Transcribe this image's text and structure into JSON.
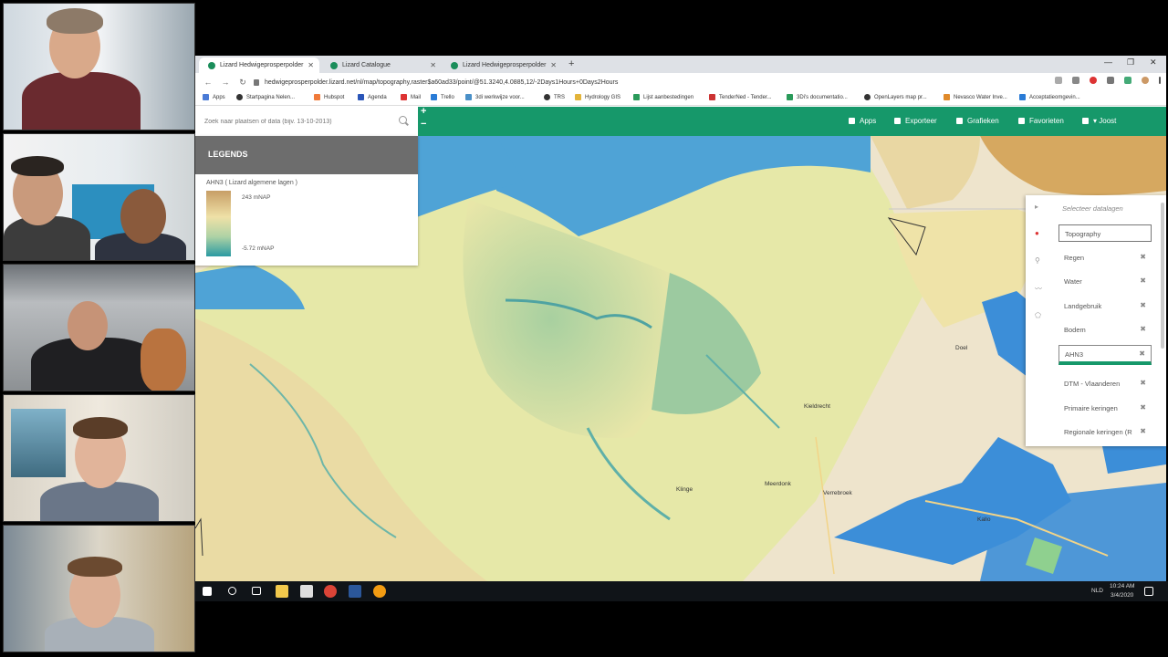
{
  "browser": {
    "tabs": [
      {
        "label": "Lizard Hedwigeprosperpolder"
      },
      {
        "label": "Lizard Catalogue"
      },
      {
        "label": "Lizard Hedwigeprosperpolder"
      }
    ],
    "url": "hedwigeprosperpolder.lizard.net/nl/map/topography,raster$a60ad33/point/@51.3240,4.0885,12/-2Days1Hours+0Days2Hours",
    "bookmarks": [
      "Apps",
      "Startpagina Nelen...",
      "Hubspot",
      "Agenda",
      "Mail",
      "Trello",
      "3di werkwijze voor...",
      "TRS",
      "Hydrology GIS",
      "Lijst aanbestedingen",
      "TenderNed - Tender...",
      "3Di's documentatio...",
      "OpenLayers map pr...",
      "Nevasco Water Inve...",
      "Acceptatieomgevin..."
    ]
  },
  "app": {
    "search_placeholder": "Zoek naar plaatsen of data (bijv. 13-10-2013)",
    "zoom_in": "+",
    "zoom_out": "−",
    "nav": {
      "apps": "Apps",
      "export": "Exporteer",
      "charts": "Grafieken",
      "favorites": "Favorieten",
      "user": "▾ Joost"
    },
    "legend": {
      "header": "LEGENDS",
      "layer": "AHN3 ( Lizard algemene lagen )",
      "max": "243 mNAP",
      "min": "-5.72 mNAP"
    },
    "layers_panel": {
      "title": "Selecteer datalagen",
      "input_value": "Topography",
      "items": [
        {
          "label": "Regen"
        },
        {
          "label": "Water"
        },
        {
          "label": "Landgebruik"
        },
        {
          "label": "Bodem"
        },
        {
          "label": "AHN3"
        },
        {
          "label": "DTM - Vlaanderen"
        },
        {
          "label": "Primaire keringen"
        },
        {
          "label": "Regionale keringen (R"
        }
      ],
      "delete_glyph": "✖"
    },
    "map_labels": {
      "doel": "Doel",
      "kieldrecht": "Kieldrecht",
      "klinge": "Klinge",
      "meerdonk": "Meerdonk",
      "verrebroek": "Verrebroek",
      "kallo": "Kallo"
    }
  },
  "taskbar": {
    "time": "10:24 AM",
    "date": "3/4/2020",
    "lang": "NLD"
  },
  "colors": {
    "accent": "#16986a",
    "legend_header": "#6d6d6d",
    "water": "#4fa3d6"
  }
}
